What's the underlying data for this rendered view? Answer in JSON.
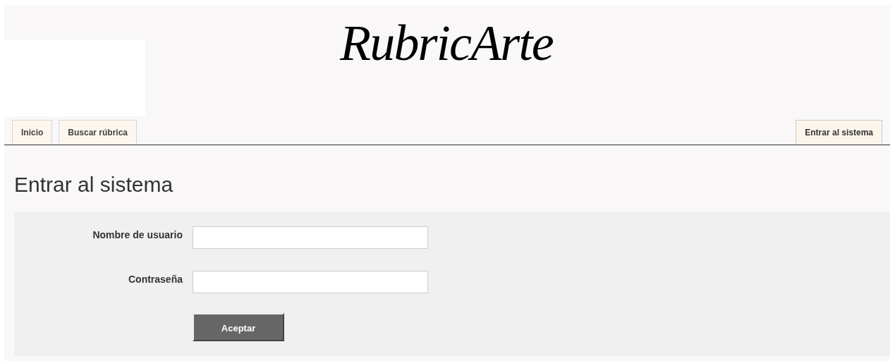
{
  "logo": {
    "text": "RubricArte"
  },
  "nav": {
    "tabs": [
      {
        "label": "Inicio",
        "selected": false
      },
      {
        "label": "Buscar rúbrica",
        "selected": false
      }
    ],
    "right_tabs": [
      {
        "label": "Entrar al sistema",
        "selected": true
      }
    ]
  },
  "page_title": "Entrar al sistema",
  "form": {
    "fields": [
      {
        "label": "Nombre de usuario"
      },
      {
        "label": "Contraseña"
      }
    ],
    "submit": "Aceptar"
  }
}
